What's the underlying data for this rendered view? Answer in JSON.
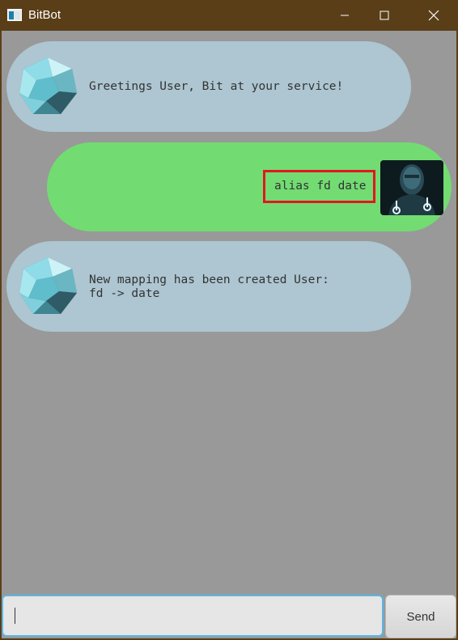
{
  "window": {
    "title": "BitBot",
    "app_icon": "app-window-icon",
    "controls": [
      "minimize-icon",
      "maximize-icon",
      "close-icon"
    ]
  },
  "chat": {
    "messages": [
      {
        "sender": "bot",
        "avatar": "crystal-bot-avatar",
        "text": "Greetings User, Bit at your service!"
      },
      {
        "sender": "user",
        "avatar": "user-avatar",
        "text": "alias fd date",
        "highlighted": true,
        "highlight_color": "#e3161f"
      },
      {
        "sender": "bot",
        "avatar": "crystal-bot-avatar",
        "text": "New mapping has been created User:\nfd -> date"
      }
    ]
  },
  "input": {
    "value": "",
    "placeholder": ""
  },
  "send_label": "Send",
  "colors": {
    "titlebar": "#5a3e18",
    "background": "#999999",
    "bot_bubble": "#adc6d1",
    "user_bubble": "#72dc72",
    "input_focus": "#5cb4e2"
  }
}
